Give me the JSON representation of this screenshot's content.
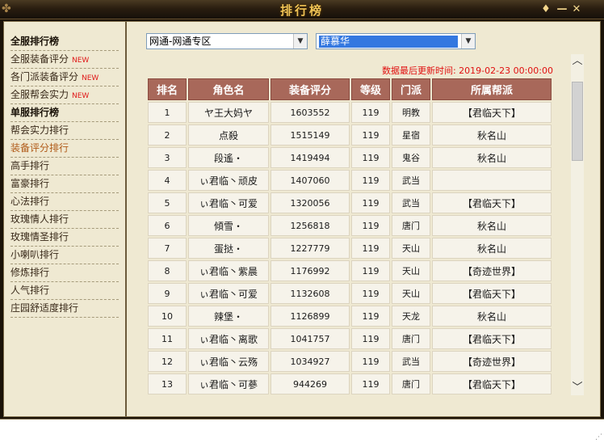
{
  "window": {
    "title": "排行榜",
    "title_icon": "decorative-swirl-icon",
    "buttons": {
      "pin": "♦",
      "minimize": "—",
      "close": "✕"
    }
  },
  "sidebar": {
    "items": [
      {
        "label": "全服排行榜",
        "type": "header",
        "new": ""
      },
      {
        "label": "全服装备评分",
        "type": "item",
        "new": "NEW"
      },
      {
        "label": "各门派装备评分",
        "type": "item",
        "new": "NEW"
      },
      {
        "label": "全服帮会实力",
        "type": "item",
        "new": "NEW"
      },
      {
        "label": "单服排行榜",
        "type": "header",
        "new": ""
      },
      {
        "label": "帮会实力排行",
        "type": "item",
        "new": ""
      },
      {
        "label": "装备评分排行",
        "type": "active",
        "new": ""
      },
      {
        "label": "高手排行",
        "type": "item",
        "new": ""
      },
      {
        "label": "富豪排行",
        "type": "item",
        "new": ""
      },
      {
        "label": "心法排行",
        "type": "item",
        "new": ""
      },
      {
        "label": "玫瑰情人排行",
        "type": "item",
        "new": ""
      },
      {
        "label": "玫瑰情圣排行",
        "type": "item",
        "new": ""
      },
      {
        "label": "小喇叭排行",
        "type": "item",
        "new": ""
      },
      {
        "label": "修炼排行",
        "type": "item",
        "new": ""
      },
      {
        "label": "人气排行",
        "type": "item",
        "new": ""
      },
      {
        "label": "庄园舒适度排行",
        "type": "item",
        "new": ""
      }
    ]
  },
  "filters": {
    "server": "网通-网通专区",
    "player": "薛慕华",
    "arrow": "▼"
  },
  "update_time": "数据最后更新时间: 2019-02-23 00:00:00",
  "table": {
    "headers": [
      "排名",
      "角色名",
      "装备评分",
      "等级",
      "门派",
      "所属帮派"
    ],
    "rows": [
      [
        "1",
        "ヤ王大妈ヤ",
        "1603552",
        "119",
        "明教",
        "【君临天下】"
      ],
      [
        "2",
        "点殺",
        "1515149",
        "119",
        "星宿",
        "秋名山"
      ],
      [
        "3",
        "段遙・",
        "1419494",
        "119",
        "鬼谷",
        "秋名山"
      ],
      [
        "4",
        "ぃ君临丶顽皮",
        "1407060",
        "119",
        "武当",
        ""
      ],
      [
        "5",
        "ぃ君临丶可爱",
        "1320056",
        "119",
        "武当",
        "【君临天下】"
      ],
      [
        "6",
        "傾雪・",
        "1256818",
        "119",
        "唐门",
        "秋名山"
      ],
      [
        "7",
        "蛋挞・",
        "1227779",
        "119",
        "天山",
        "秋名山"
      ],
      [
        "8",
        "ぃ君临丶紫晨",
        "1176992",
        "119",
        "天山",
        "【奇迹世界】"
      ],
      [
        "9",
        "ぃ君临丶可爱",
        "1132608",
        "119",
        "天山",
        "【君临天下】"
      ],
      [
        "10",
        "辣堡・",
        "1126899",
        "119",
        "天龙",
        "秋名山"
      ],
      [
        "11",
        "ぃ君临丶离歌",
        "1041757",
        "119",
        "唐门",
        "【君临天下】"
      ],
      [
        "12",
        "ぃ君临丶云殇",
        "1034927",
        "119",
        "武当",
        "【奇迹世界】"
      ],
      [
        "13",
        "ぃ君临丶可蔘",
        "944269",
        "119",
        "唐门",
        "【君临天下】"
      ]
    ]
  },
  "scrollbar": {
    "up": "︿",
    "down": "﹀"
  }
}
